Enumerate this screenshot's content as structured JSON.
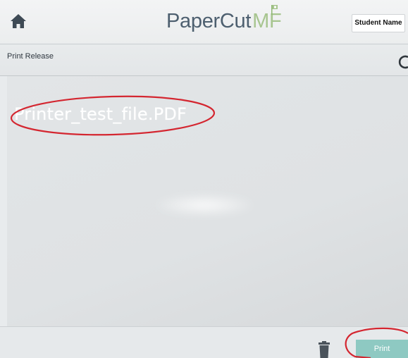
{
  "header": {
    "logo_part1": "PaperCut",
    "logo_part2": "MF",
    "user_label": "Student Name"
  },
  "subheader": {
    "title": "Print Release",
    "refresh_glyph": "C"
  },
  "jobs": [
    {
      "name": "Printer_test_file.PDF"
    }
  ],
  "footer": {
    "print_label": "Print"
  },
  "icons": {
    "home": "home-icon",
    "trash": "trash-icon",
    "refresh": "refresh-icon"
  },
  "colors": {
    "logo_dark": "#4d5f6f",
    "logo_accent": "#a7c58f",
    "print_button": "#8ec9c2",
    "annotation": "#d42630"
  }
}
